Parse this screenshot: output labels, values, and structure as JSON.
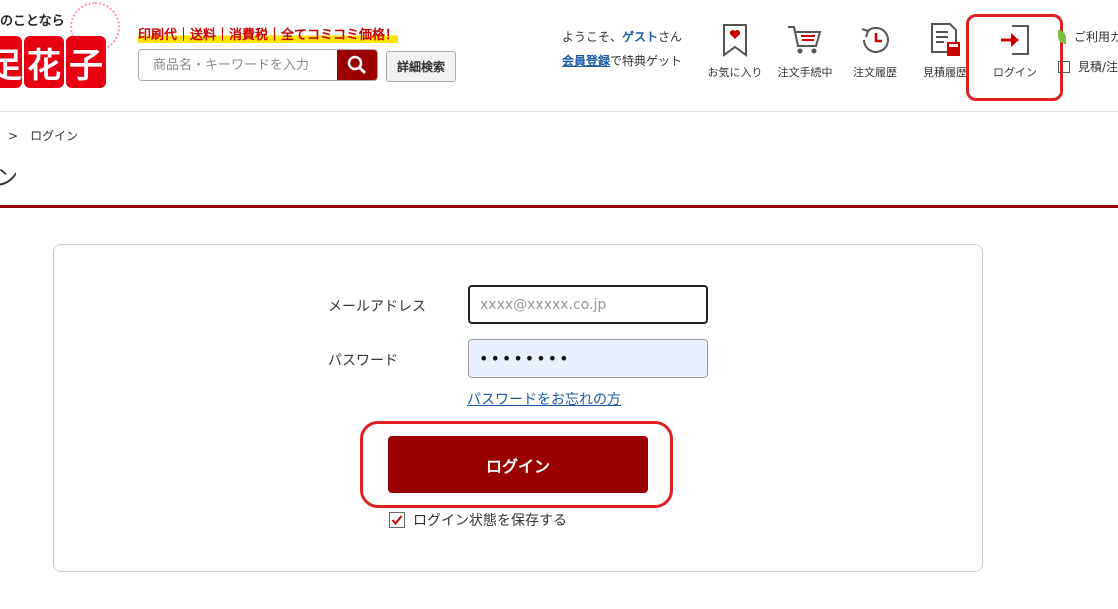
{
  "header": {
    "logo_tagline": "のことなら",
    "logo_chars": [
      "足",
      "花",
      "子"
    ],
    "promo": "印刷代｜送料｜消費税｜全てコミコミ価格！",
    "search_placeholder": "商品名・キーワードを入力",
    "advanced_search": "詳細検索",
    "welcome_prefix": "ようこそ、",
    "welcome_name": "ゲスト",
    "welcome_suffix": "さん",
    "register_link": "会員登録",
    "register_suffix": "で特典ゲット",
    "nav": [
      {
        "label": "お気に入り",
        "icon": "bookmark-heart-icon"
      },
      {
        "label": "注文手続中",
        "icon": "cart-icon"
      },
      {
        "label": "注文履歴",
        "icon": "clock-history-icon"
      },
      {
        "label": "見積履歴",
        "icon": "estimate-document-icon"
      },
      {
        "label": "ログイン",
        "icon": "login-arrow-icon"
      }
    ],
    "right_links": [
      "ご利用ガ",
      "見積/注"
    ]
  },
  "breadcrumb": [
    ">",
    "ログイン"
  ],
  "page_title_fragment": "ン",
  "form": {
    "email_label": "メールアドレス",
    "email_placeholder": "xxxx@xxxxx.co.jp",
    "password_label": "パスワード",
    "password_value": "••••••••",
    "forgot_link": "パスワードをお忘れの方",
    "login_button": "ログイン",
    "remember_label": "ログイン状態を保存する",
    "remember_checked": true
  },
  "colors": {
    "brand_red": "#e60012",
    "dark_red": "#9a0000",
    "highlight": "#e02020",
    "link_blue": "#1a5aa8"
  }
}
